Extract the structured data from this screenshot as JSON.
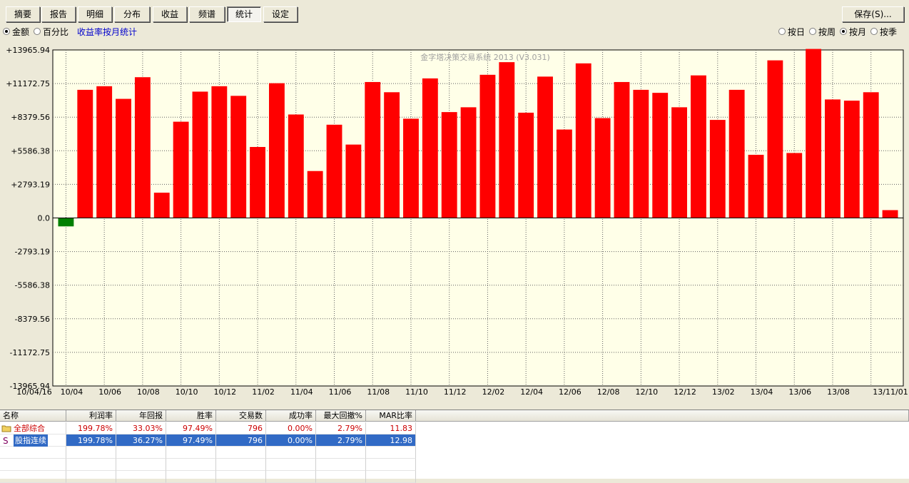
{
  "toolbar": {
    "tabs": [
      "摘要",
      "报告",
      "明细",
      "分布",
      "收益",
      "频谱",
      "统计",
      "设定"
    ],
    "active_tab": "统计",
    "save_label": "保存(S)..."
  },
  "options": {
    "mode_amount": "金额",
    "mode_percent": "百分比",
    "mode_selected": "金额",
    "link": "收益率按月统计",
    "period_day": "按日",
    "period_week": "按周",
    "period_month": "按月",
    "period_quarter": "按季",
    "period_selected": "按月"
  },
  "chart_data": {
    "type": "bar",
    "watermark": "金字塔决策交易系统 2013 (V3.031)",
    "y_ticks": [
      "+13965.94",
      "+11172.75",
      "+8379.56",
      "+5586.38",
      "+2793.19",
      "0.0",
      "-2793.19",
      "-5586.38",
      "-8379.56",
      "-11172.75",
      "-13965.94"
    ],
    "ylim": [
      -13965.94,
      13965.94
    ],
    "x_labels": [
      "10/04/16",
      "10/04",
      "10/06",
      "10/08",
      "10/10",
      "10/12",
      "11/02",
      "11/04",
      "11/06",
      "11/08",
      "11/10",
      "11/12",
      "12/02",
      "12/04",
      "12/06",
      "12/08",
      "12/10",
      "12/12",
      "13/02",
      "13/04",
      "13/06",
      "13/08",
      "13/11/01"
    ],
    "categories": [
      "10/04",
      "10/05",
      "10/06",
      "10/07",
      "10/08",
      "10/09",
      "10/10",
      "10/11",
      "10/12",
      "11/01",
      "11/02",
      "11/03",
      "11/04",
      "11/05",
      "11/06",
      "11/07",
      "11/08",
      "11/09",
      "11/10",
      "11/11",
      "11/12",
      "12/01",
      "12/02",
      "12/03",
      "12/04",
      "12/05",
      "12/06",
      "12/07",
      "12/08",
      "12/09",
      "12/10",
      "12/11",
      "12/12",
      "13/01",
      "13/02",
      "13/03",
      "13/04",
      "13/05",
      "13/06",
      "13/07",
      "13/08",
      "13/09",
      "13/10",
      "13/11"
    ],
    "values": [
      -700,
      10650,
      10950,
      9900,
      11700,
      2100,
      8000,
      10500,
      10950,
      10150,
      5900,
      11200,
      8600,
      3900,
      7750,
      6100,
      11300,
      10450,
      8250,
      11600,
      8800,
      9200,
      11900,
      12950,
      8750,
      11750,
      7350,
      12850,
      8300,
      11300,
      10650,
      10400,
      9200,
      11850,
      8150,
      10650,
      5250,
      13100,
      5400,
      14050,
      9850,
      9750,
      10450,
      650
    ],
    "colors": {
      "positive": "#ff0000",
      "negative": "#008000"
    }
  },
  "table": {
    "headers": [
      "名称",
      "利润率",
      "年回报",
      "胜率",
      "交易数",
      "成功率",
      "最大回撤%",
      "MAR比率"
    ],
    "rows": [
      {
        "icon": "folder-icon",
        "cells": [
          "全部综合",
          "199.78%",
          "33.03%",
          "97.49%",
          "796",
          "0.00%",
          "2.79%",
          "11.83"
        ]
      },
      {
        "icon": "strategy-s-icon",
        "cells": [
          "股指连续",
          "199.78%",
          "36.27%",
          "97.49%",
          "796",
          "0.00%",
          "2.79%",
          "12.98"
        ]
      }
    ]
  }
}
